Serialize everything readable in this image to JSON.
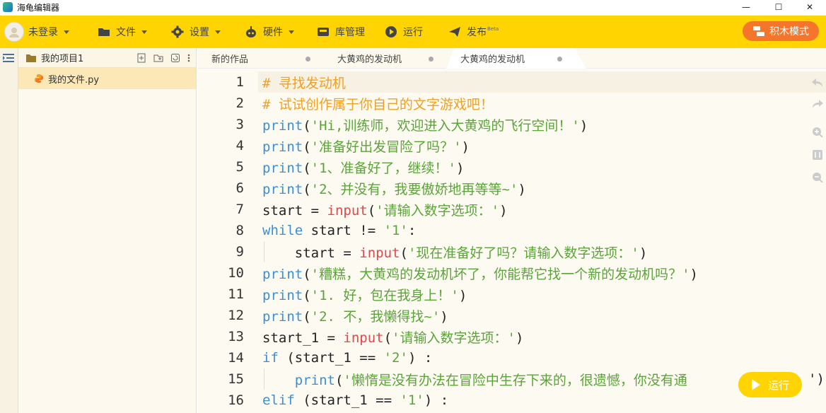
{
  "window": {
    "title": "海龟编辑器",
    "minimize": "—",
    "maximize": "☐",
    "close": "✕"
  },
  "menubar": {
    "user": "未登录",
    "file": "文件",
    "settings": "设置",
    "hardware": "硬件",
    "library": "库管理",
    "run": "运行",
    "publish": "发布",
    "publish_badge": "Beta",
    "block_mode": "积木模式"
  },
  "sidebar": {
    "project_title": "我的项目1",
    "files": [
      {
        "name": "我的文件.py"
      }
    ]
  },
  "tabs": [
    {
      "label": "新的作品"
    },
    {
      "label": "大黄鸡的发动机"
    },
    {
      "label": "大黄鸡的发动机"
    }
  ],
  "editor": {
    "line_numbers": [
      "1",
      "2",
      "3",
      "4",
      "5",
      "6",
      "7",
      "8",
      "9",
      "10",
      "11",
      "12",
      "13",
      "14",
      "15",
      "16"
    ],
    "lines": [
      [
        {
          "t": "# 寻找发动机",
          "c": "comment"
        }
      ],
      [
        {
          "t": "# 试试创作属于你自己的文字游戏吧！",
          "c": "comment"
        }
      ],
      [
        {
          "t": "print",
          "c": "kw"
        },
        {
          "t": "(",
          "c": ""
        },
        {
          "t": "'Hi,训练师，欢迎进入大黄鸡的飞行空间！'",
          "c": "str"
        },
        {
          "t": ")",
          "c": ""
        }
      ],
      [
        {
          "t": "print",
          "c": "kw"
        },
        {
          "t": "(",
          "c": ""
        },
        {
          "t": "'准备好出发冒险了吗？'",
          "c": "str"
        },
        {
          "t": ")",
          "c": ""
        }
      ],
      [
        {
          "t": "print",
          "c": "kw"
        },
        {
          "t": "(",
          "c": ""
        },
        {
          "t": "'1、准备好了，继续！'",
          "c": "str"
        },
        {
          "t": ")",
          "c": ""
        }
      ],
      [
        {
          "t": "print",
          "c": "kw"
        },
        {
          "t": "(",
          "c": ""
        },
        {
          "t": "'2、并没有，我要傲娇地再等等~'",
          "c": "str"
        },
        {
          "t": ")",
          "c": ""
        }
      ],
      [
        {
          "t": "start = ",
          "c": ""
        },
        {
          "t": "input",
          "c": "fn"
        },
        {
          "t": "(",
          "c": ""
        },
        {
          "t": "'请输入数字选项：'",
          "c": "str"
        },
        {
          "t": ")",
          "c": ""
        }
      ],
      [
        {
          "t": "while",
          "c": "kw"
        },
        {
          "t": " start != ",
          "c": ""
        },
        {
          "t": "'1'",
          "c": "str"
        },
        {
          "t": ":",
          "c": ""
        }
      ],
      [
        {
          "t": "    start = ",
          "c": ""
        },
        {
          "t": "input",
          "c": "fn"
        },
        {
          "t": "(",
          "c": ""
        },
        {
          "t": "'现在准备好了吗？请输入数字选项：'",
          "c": "str"
        },
        {
          "t": ")",
          "c": ""
        }
      ],
      [
        {
          "t": "print",
          "c": "kw"
        },
        {
          "t": "(",
          "c": ""
        },
        {
          "t": "'糟糕，大黄鸡的发动机坏了，你能帮它找一个新的发动机吗？'",
          "c": "str"
        },
        {
          "t": ")",
          "c": ""
        }
      ],
      [
        {
          "t": "print",
          "c": "kw"
        },
        {
          "t": "(",
          "c": ""
        },
        {
          "t": "'1. 好，包在我身上！'",
          "c": "str"
        },
        {
          "t": ")",
          "c": ""
        }
      ],
      [
        {
          "t": "print",
          "c": "kw"
        },
        {
          "t": "(",
          "c": ""
        },
        {
          "t": "'2. 不，我懒得找~'",
          "c": "str"
        },
        {
          "t": ")",
          "c": ""
        }
      ],
      [
        {
          "t": "start_1 = ",
          "c": ""
        },
        {
          "t": "input",
          "c": "fn"
        },
        {
          "t": "(",
          "c": ""
        },
        {
          "t": "'请输入数字选项：'",
          "c": "str"
        },
        {
          "t": ")",
          "c": ""
        }
      ],
      [
        {
          "t": "if",
          "c": "kw"
        },
        {
          "t": " (start_1 == ",
          "c": ""
        },
        {
          "t": "'2'",
          "c": "str"
        },
        {
          "t": ") :",
          "c": ""
        }
      ],
      [
        {
          "t": "    ",
          "c": ""
        },
        {
          "t": "print",
          "c": "kw"
        },
        {
          "t": "(",
          "c": ""
        },
        {
          "t": "'懒惰是没有办法在冒险中生存下来的，很遗憾，你没有通",
          "c": "str"
        }
      ],
      [
        {
          "t": "elif",
          "c": "kw"
        },
        {
          "t": " (start_1 == ",
          "c": ""
        },
        {
          "t": "'1'",
          "c": "str"
        },
        {
          "t": ") :",
          "c": ""
        }
      ]
    ],
    "line15_tail": "')"
  },
  "run_button": "运行",
  "colors": {
    "accent": "#ffd400",
    "block_mode": "#f5752b",
    "comment": "#f0a022",
    "keyword": "#3a8fd6",
    "function": "#e0474c",
    "string": "#5aa43a"
  }
}
